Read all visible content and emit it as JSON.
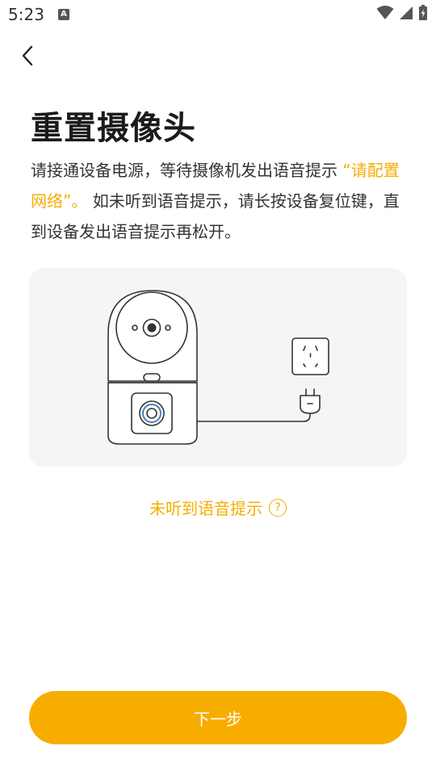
{
  "status_bar": {
    "time": "5:23",
    "notification_icon_letter": "A"
  },
  "header": {
    "back_icon": "chevron-left-icon"
  },
  "title": "重置摄像头",
  "description": {
    "text_before": "请接通设备电源，等待摄像机发出语音提示 ",
    "highlight": "“请配置网络”。",
    "text_after": " 如未听到语音提示，请长按设备复位键，直到设备发出语音提示再松开。"
  },
  "help": {
    "label": "未听到语音提示",
    "icon": "question-circle-icon",
    "icon_glyph": "?"
  },
  "next_button": {
    "label": "下一步"
  },
  "colors": {
    "accent": "#f7ad00",
    "card_background": "#f5f5f5",
    "text_primary": "#1a1a1a"
  }
}
